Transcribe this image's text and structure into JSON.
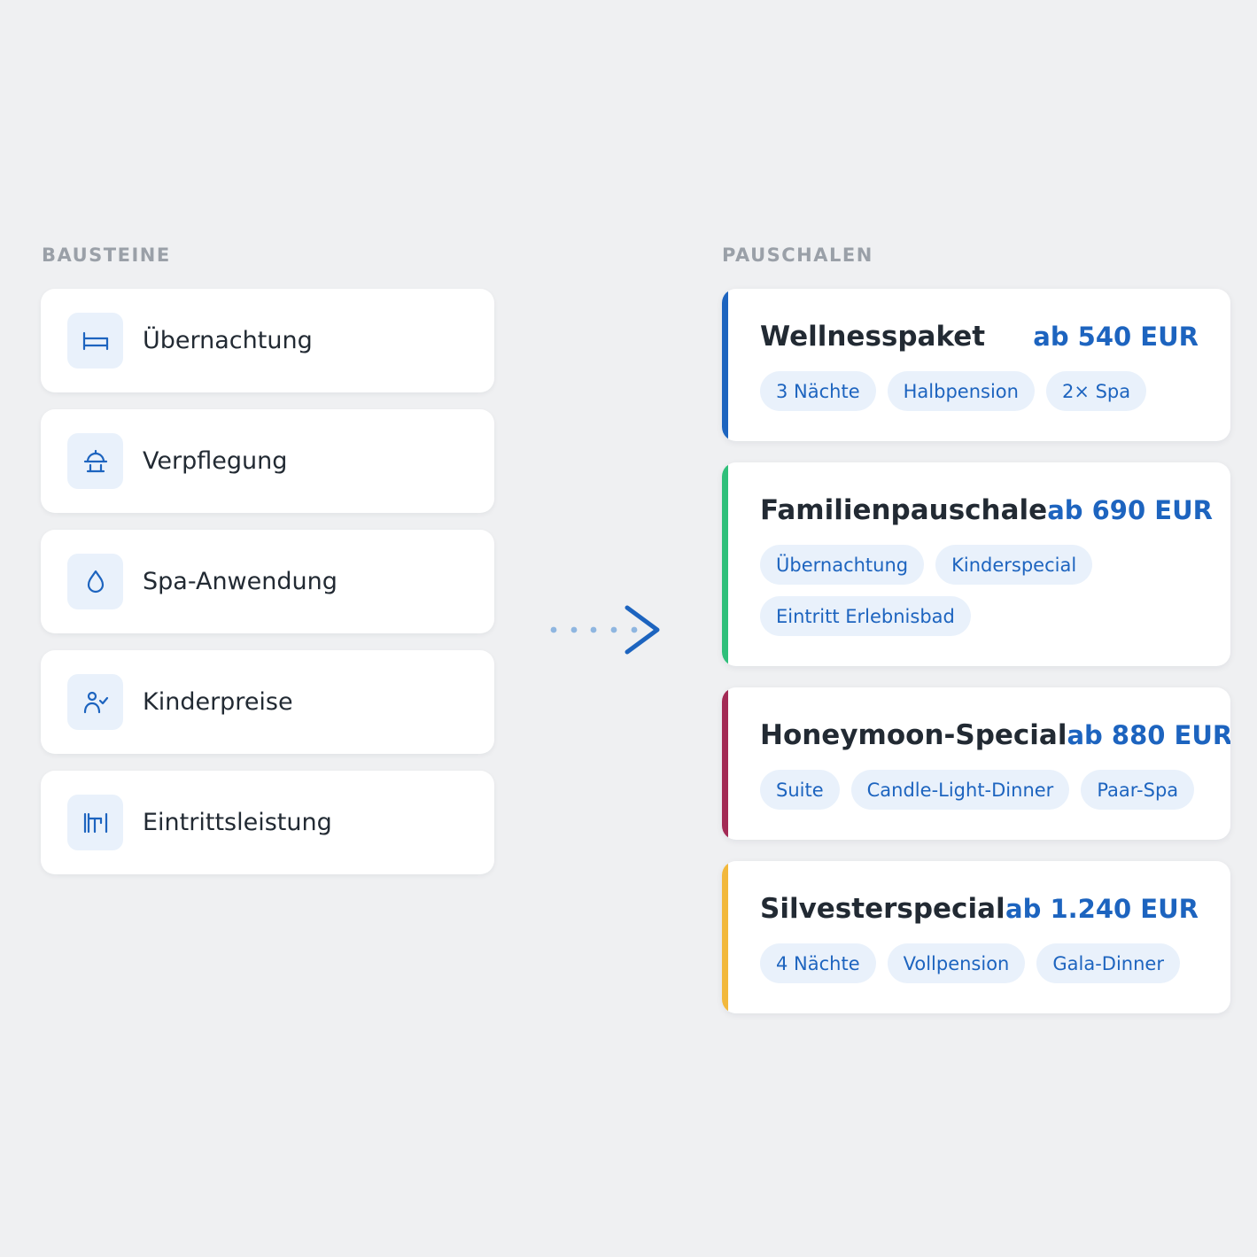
{
  "left_section": {
    "label": "BAUSTEINE"
  },
  "right_section": {
    "label": "PAUSCHALEN"
  },
  "blocks": [
    {
      "label": "Übernachtung",
      "icon": "bed-icon"
    },
    {
      "label": "Verpflegung",
      "icon": "dining-icon"
    },
    {
      "label": "Spa-Anwendung",
      "icon": "water-drop-icon"
    },
    {
      "label": "Kinderpreise",
      "icon": "child-check-icon"
    },
    {
      "label": "Eintrittsleistung",
      "icon": "ticket-gate-icon"
    }
  ],
  "packages": [
    {
      "name": "Wellnesspaket",
      "price": "ab 540 EUR",
      "accent": "#1d64bf",
      "tags": [
        "3 Nächte",
        "Halbpension",
        "2× Spa"
      ]
    },
    {
      "name": "Familienpauschale",
      "price": "ab 690 EUR",
      "accent": "#2fbf7a",
      "tags": [
        "Übernachtung",
        "Kinderspecial",
        "Eintritt Erlebnisbad"
      ]
    },
    {
      "name": "Honeymoon-Special",
      "price": "ab 880 EUR",
      "accent": "#a32a55",
      "tags": [
        "Suite",
        "Candle-Light-Dinner",
        "Paar-Spa"
      ]
    },
    {
      "name": "Silvesterspecial",
      "price": "ab 1.240 EUR",
      "accent": "#f2b83c",
      "tags": [
        "4 Nächte",
        "Vollpension",
        "Gala-Dinner"
      ]
    }
  ],
  "colors": {
    "primary": "#1d64bf",
    "arrow_dots": "#8fb6e0"
  }
}
